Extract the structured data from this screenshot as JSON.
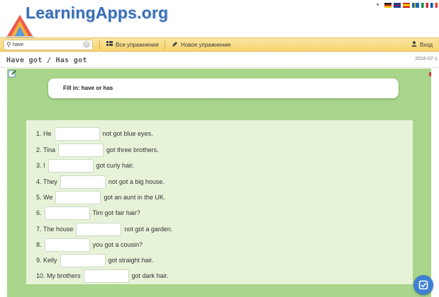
{
  "header": {
    "logo_text": "LearningApps.org",
    "language_flags": [
      {
        "name": "german-flag",
        "colors": [
          "#222222",
          "#d52b1e",
          "#f7c400"
        ]
      },
      {
        "name": "uk-flag",
        "colors": [
          "#1f3f8f",
          "#ffffff",
          "#c8102e"
        ]
      },
      {
        "name": "spanish-flag",
        "colors": [
          "#c60b1e",
          "#ffc400",
          "#c60b1e"
        ]
      },
      {
        "name": "swedish-flag",
        "colors": [
          "#1a66b5",
          "#fecc00",
          "#1a66b5"
        ]
      },
      {
        "name": "italian-flag",
        "colors": [
          "#009246",
          "#ffffff",
          "#ce2b37"
        ]
      },
      {
        "name": "french-flag",
        "colors": [
          "#0055a4",
          "#ffffff",
          "#ef4135"
        ]
      }
    ]
  },
  "toolbar": {
    "search_value": "have",
    "all_exercises_label": "Все упражнения",
    "new_exercise_label": "Новое упражнение",
    "login_label": "Вход"
  },
  "page": {
    "title": "Have got / Has got",
    "date": "2016-07-1"
  },
  "exercise": {
    "instruction": "Fill in: have or has",
    "items": [
      {
        "before": "1. He",
        "after": "not got blue eyes."
      },
      {
        "before": "2. Tina",
        "after": "got three brothers."
      },
      {
        "before": "3. I",
        "after": "got curly hair."
      },
      {
        "before": "4. They",
        "after": "not got a big house."
      },
      {
        "before": "5. We",
        "after": "got an aunt in the UK."
      },
      {
        "before": "6.",
        "after": "Tim got fair hair?"
      },
      {
        "before": "7. The house",
        "after": "not got a garden."
      },
      {
        "before": "8.",
        "after": "you got a cousin?"
      },
      {
        "before": "9. Kelly",
        "after": "got straight hair."
      },
      {
        "before": "10. My brothers",
        "after": "got dark hair."
      }
    ]
  },
  "colors": {
    "toolbar": "#f6d46f",
    "app_background": "#a9d58a",
    "panel": "#e7f3d8",
    "logo": "#3a6fb5",
    "check_button": "#3f7fd1"
  }
}
